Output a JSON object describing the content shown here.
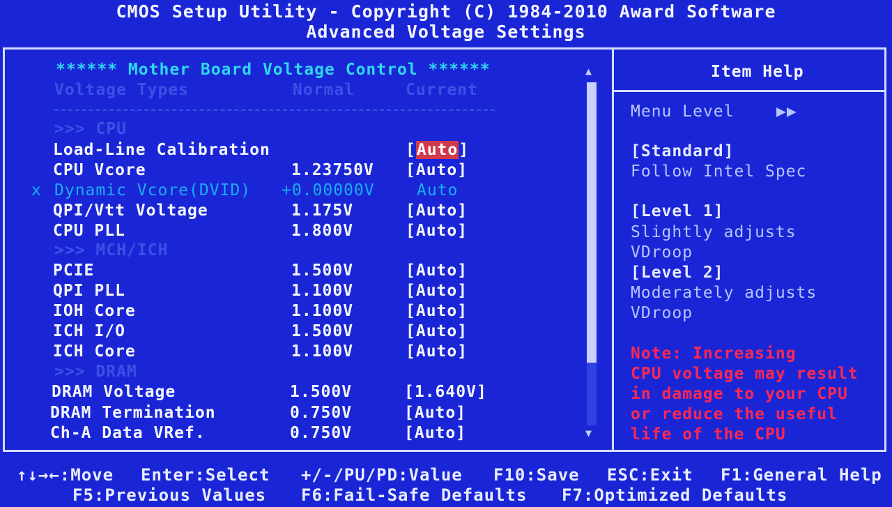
{
  "header": {
    "title": "CMOS Setup Utility - Copyright (C) 1984-2010 Award Software",
    "subtitle": "Advanced Voltage Settings"
  },
  "main": {
    "section_title": "****** Mother Board Voltage Control ******",
    "columns": {
      "type": "Voltage Types",
      "normal": "Normal",
      "current": "Current"
    },
    "groups": {
      "cpu": ">>> CPU",
      "mch": ">>> MCH/ICH",
      "dram": ">>> DRAM"
    },
    "items": [
      {
        "label": "Load-Line Calibration",
        "normal": "",
        "value": "Auto"
      },
      {
        "label": "CPU Vcore",
        "normal": "1.23750V",
        "value": "Auto"
      },
      {
        "label": "Dynamic Vcore(DVID)",
        "normal": "+0.00000V",
        "value": "Auto",
        "marker": "x"
      },
      {
        "label": "QPI/Vtt Voltage",
        "normal": "1.175V",
        "value": "Auto"
      },
      {
        "label": "CPU PLL",
        "normal": "1.800V",
        "value": "Auto"
      },
      {
        "label": "PCIE",
        "normal": "1.500V",
        "value": "Auto"
      },
      {
        "label": "QPI PLL",
        "normal": "1.100V",
        "value": "Auto"
      },
      {
        "label": "IOH Core",
        "normal": "1.100V",
        "value": "Auto"
      },
      {
        "label": "ICH I/O",
        "normal": "1.500V",
        "value": "Auto"
      },
      {
        "label": "ICH Core",
        "normal": "1.100V",
        "value": "Auto"
      },
      {
        "label": "DRAM Voltage",
        "normal": "1.500V",
        "value": "1.640V"
      },
      {
        "label": "DRAM Termination",
        "normal": "0.750V",
        "value": "Auto"
      },
      {
        "label": "Ch-A Data VRef.",
        "normal": "0.750V",
        "value": "Auto"
      }
    ]
  },
  "help": {
    "title": "Item Help",
    "menu_level": "Menu Level",
    "menu_level_arrows": "▶▶",
    "lines": [
      "[Standard]",
      "Follow Intel Spec",
      "[Level 1]",
      "Slightly adjusts",
      "VDroop",
      "[Level 2]",
      "Moderately adjusts",
      "VDroop"
    ],
    "note": [
      "Note: Increasing",
      "CPU voltage may result",
      "in damage to your CPU",
      "or reduce the useful",
      "life of the CPU"
    ]
  },
  "footer": {
    "line1": [
      "↑↓→←:Move",
      "Enter:Select",
      "+/-/PU/PD:Value",
      "F10:Save",
      "ESC:Exit",
      "F1:General Help"
    ],
    "line2": [
      "F5:Previous Values",
      "F6:Fail-Safe Defaults",
      "F7:Optimized Defaults"
    ]
  },
  "colors": {
    "background": "#1a26d6",
    "section_title": "#2fd8ee",
    "note": "#ff2850",
    "highlight": "#d03a4a"
  }
}
